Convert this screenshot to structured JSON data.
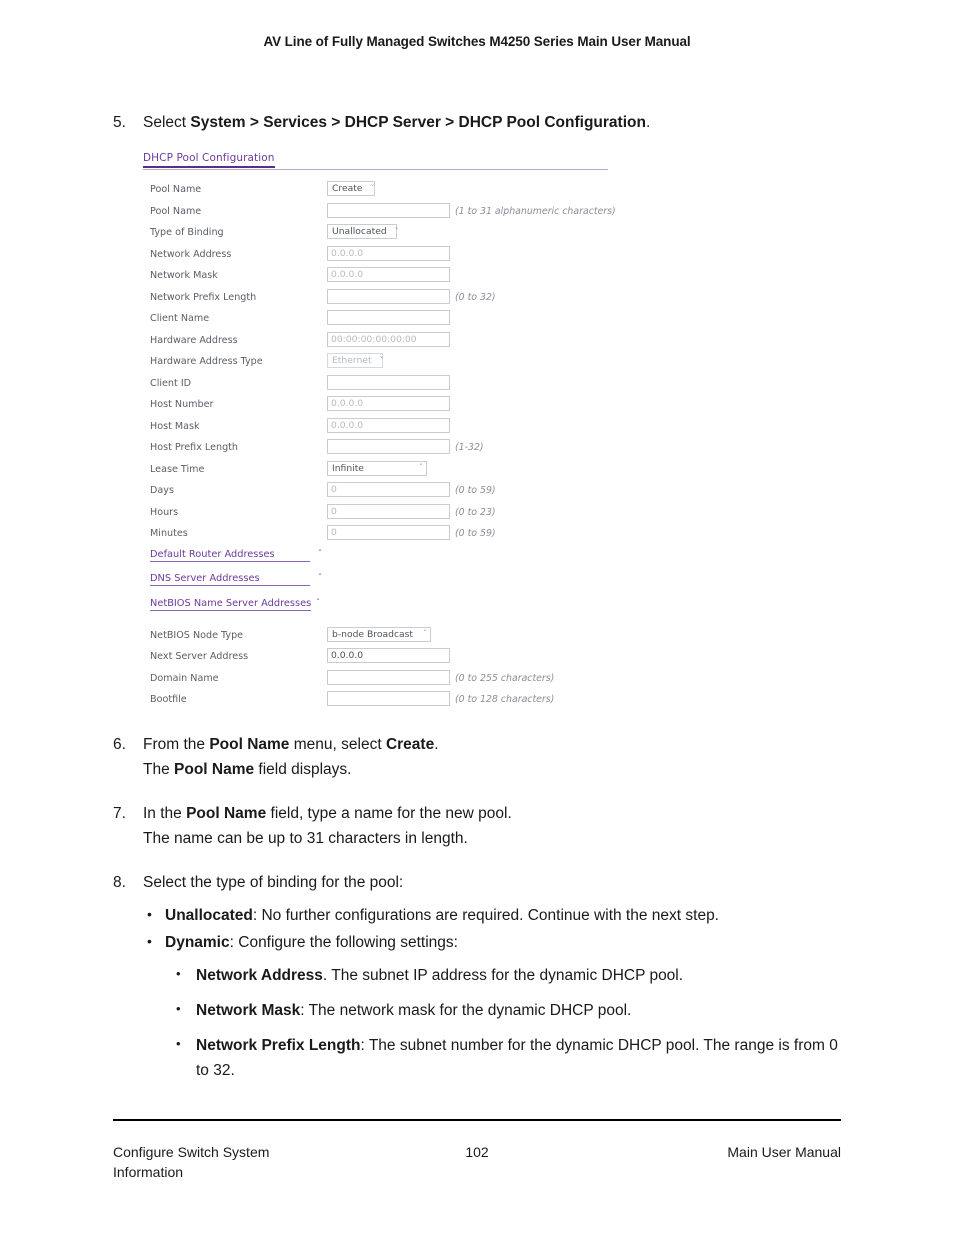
{
  "running_head": "AV Line of Fully Managed Switches M4250 Series Main User Manual",
  "steps": {
    "step5": {
      "num": "5.",
      "pre": "Select ",
      "bold": "System > Services > DHCP Server > DHCP Pool Configuration",
      "post": "."
    },
    "step6": {
      "num": "6.",
      "line1_pre": "From the ",
      "line1_b1": "Pool Name",
      "line1_mid": " menu, select ",
      "line1_b2": "Create",
      "line1_post": ".",
      "line2_pre": "The ",
      "line2_b1": "Pool Name",
      "line2_post": " field displays."
    },
    "step7": {
      "num": "7.",
      "line1_pre": "In the ",
      "line1_b1": "Pool Name",
      "line1_post": " field, type a name for the new pool.",
      "line2": "The name can be up to 31 characters in length."
    },
    "step8": {
      "num": "8.",
      "line1": "Select the type of binding for the pool:"
    }
  },
  "bullets_level1": [
    {
      "term": "Unallocated",
      "sep": ": ",
      "text": "No further configurations are required. Continue with the next step."
    },
    {
      "term": "Dynamic",
      "sep": ": ",
      "text": "Configure the following settings:"
    }
  ],
  "bullets_level2": [
    {
      "term": "Network Address",
      "sep": ". ",
      "text": "The subnet IP address for the dynamic DHCP pool."
    },
    {
      "term": "Network Mask",
      "sep": ": ",
      "text": "The network mask for the dynamic DHCP pool."
    },
    {
      "term": "Network Prefix Length",
      "sep": ": ",
      "text": "The subnet number for the dynamic DHCP pool. The range is from 0 to 32."
    }
  ],
  "screenshot": {
    "title": "DHCP Pool Configuration",
    "accent_color": "#5b2d87",
    "rows": [
      {
        "label": "Pool Name",
        "control": "select",
        "value": "Create",
        "hint": ""
      },
      {
        "label": "Pool Name",
        "control": "input",
        "value": "",
        "hint": "(1 to 31 alphanumeric characters)"
      },
      {
        "label": "Type of Binding",
        "control": "select",
        "value": "Unallocated",
        "hint": ""
      },
      {
        "label": "Network Address",
        "control": "input",
        "value": "0.0.0.0",
        "hint": ""
      },
      {
        "label": "Network Mask",
        "control": "input",
        "value": "0.0.0.0",
        "hint": ""
      },
      {
        "label": "Network Prefix Length",
        "control": "input",
        "value": "",
        "hint": "(0 to 32)"
      },
      {
        "label": "Client Name",
        "control": "input",
        "value": "",
        "hint": ""
      },
      {
        "label": "Hardware Address",
        "control": "input",
        "value": "00:00:00:00:00:00",
        "hint": ""
      },
      {
        "label": "Hardware Address Type",
        "control": "select",
        "value": "Ethernet",
        "hint": ""
      },
      {
        "label": "Client ID",
        "control": "input",
        "value": "",
        "hint": ""
      },
      {
        "label": "Host Number",
        "control": "input",
        "value": "0.0.0.0",
        "hint": ""
      },
      {
        "label": "Host Mask",
        "control": "input",
        "value": "0.0.0.0",
        "hint": ""
      },
      {
        "label": "Host Prefix Length",
        "control": "input",
        "value": "",
        "hint": "(1-32)"
      },
      {
        "label": "Lease Time",
        "control": "select",
        "value": "Infinite",
        "hint": ""
      },
      {
        "label": "Days",
        "control": "input",
        "value": "0",
        "hint": "(0 to 59)"
      },
      {
        "label": "Hours",
        "control": "input",
        "value": "0",
        "hint": "(0 to 23)"
      },
      {
        "label": "Minutes",
        "control": "input",
        "value": "0",
        "hint": "(0 to 59)"
      }
    ],
    "expandables": [
      {
        "label": "Default Router Addresses",
        "chevron": "ˇ"
      },
      {
        "label": "DNS Server Addresses",
        "chevron": "ˇ"
      },
      {
        "label": "NetBIOS Name Server Addresses",
        "chevron": "ˇ"
      }
    ],
    "rows_bottom": [
      {
        "label": "NetBIOS Node Type",
        "control": "select",
        "value": "b-node Broadcast",
        "hint": ""
      },
      {
        "label": "Next Server Address",
        "control": "input",
        "value": "0.0.0.0",
        "hint": ""
      },
      {
        "label": "Domain Name",
        "control": "input",
        "value": "",
        "hint": "(0 to 255 characters)"
      },
      {
        "label": "Bootfile",
        "control": "input",
        "value": "",
        "hint": "(0 to 128 characters)"
      }
    ],
    "chevron_glyph": "ˇ"
  },
  "footer": {
    "left": "Configure Switch System Information",
    "page": "102",
    "right": "Main User Manual"
  }
}
